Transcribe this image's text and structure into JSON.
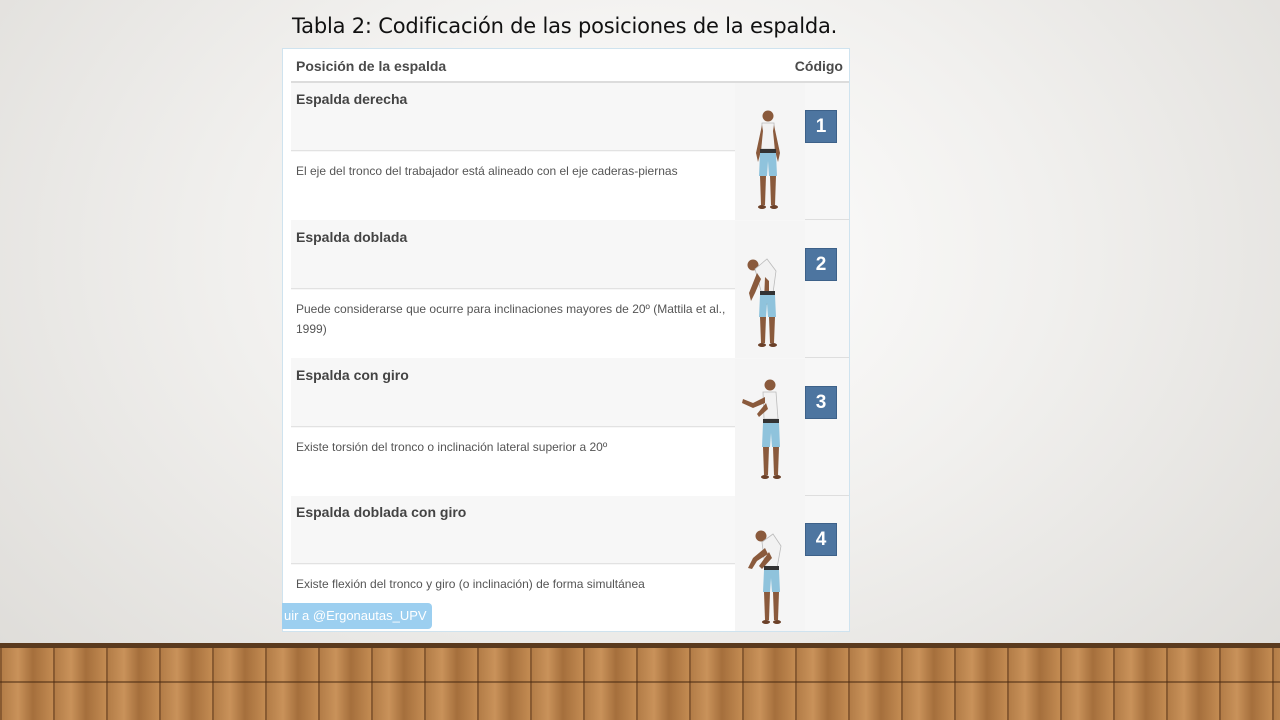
{
  "slide": {
    "title": "Tabla 2: Codificación de las posiciones de la espalda."
  },
  "table": {
    "header": {
      "position_label": "Posición de la espalda",
      "code_label": "Código"
    },
    "rows": [
      {
        "title": "Espalda derecha",
        "description": "El eje del tronco del trabajador está alineado con el eje caderas-piernas",
        "code": "1",
        "figure_icon": "standing-upright-figure"
      },
      {
        "title": "Espalda doblada",
        "description": "Puede considerarse que ocurre para inclinaciones mayores de 20º (Mattila et al., 1999)",
        "code": "2",
        "figure_icon": "bent-forward-figure"
      },
      {
        "title": "Espalda con giro",
        "description": "Existe torsión del tronco o inclinación lateral superior a 20º",
        "code": "3",
        "figure_icon": "twisted-trunk-figure"
      },
      {
        "title": "Espalda doblada con giro",
        "description": "Existe flexión del tronco y giro (o inclinación) de forma simultánea",
        "code": "4",
        "figure_icon": "bent-twisted-figure"
      }
    ]
  },
  "twitter_button": {
    "label": "uir a @Ergonautas_UPV"
  },
  "colors": {
    "code_badge": "#4d75a0",
    "twitter_button": "#9ccff0",
    "floor": "#b07a45"
  }
}
